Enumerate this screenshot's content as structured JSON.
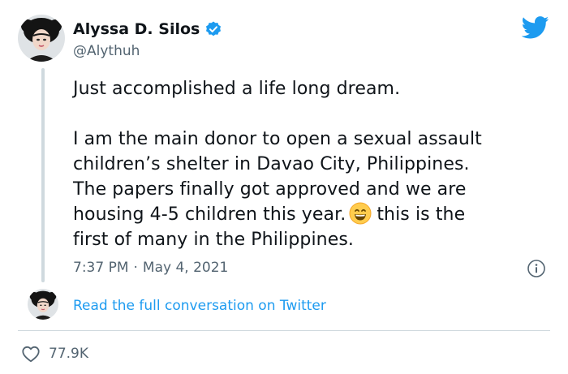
{
  "author": {
    "name": "Alyssa D. Silos",
    "handle": "@Alythuh",
    "verified": true
  },
  "tweet": {
    "paragraph1": "Just accomplished a life long dream.",
    "lines": [
      "I am the main donor to open a sexual assault",
      "children’s shelter in Davao City, Philippines.",
      "The papers finally got approved and we are"
    ],
    "line4_before_emoji": "housing 4-5 children this year.",
    "emoji": "grinning-face-with-smiling-eyes-emoji",
    "line4_after_emoji": "this is the",
    "line5": "first of many in the Philippines."
  },
  "meta": {
    "time": "7:37 PM",
    "separator": "·",
    "date": "May 4, 2021"
  },
  "links": {
    "read_full": "Read the full conversation on Twitter"
  },
  "engagement": {
    "likes": "77.9K"
  },
  "icons": {
    "brand": "twitter-bird-icon",
    "verified": "verified-badge-icon",
    "info": "info-icon",
    "like": "heart-icon"
  },
  "colors": {
    "twitter_blue": "#1d9bf0",
    "text_primary": "#0f1419",
    "text_secondary": "#536471",
    "border": "#cfd9de"
  }
}
